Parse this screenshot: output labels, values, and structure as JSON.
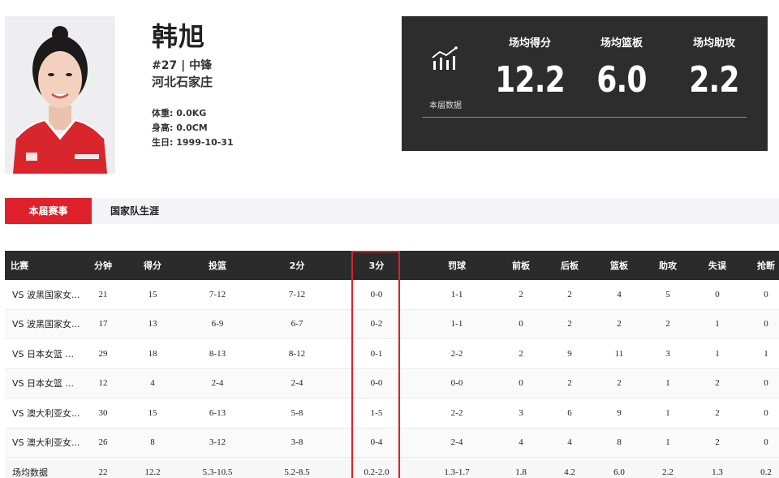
{
  "player": {
    "name": "韩旭",
    "number_position": "#27 | 中锋",
    "origin": "河北石家庄",
    "weight_label": "体重: ",
    "weight": "0.0KG",
    "height_label": "身高: ",
    "height": "0.0CM",
    "birth_label": "生日: ",
    "birth": "1999-10-31"
  },
  "season_stats": {
    "label": "本届数据",
    "icon": "chart-icon",
    "items": [
      {
        "label": "场均得分",
        "value": "12.2"
      },
      {
        "label": "场均篮板",
        "value": "6.0"
      },
      {
        "label": "场均助攻",
        "value": "2.2"
      }
    ]
  },
  "tabs": [
    {
      "label": "本届赛事",
      "active": true
    },
    {
      "label": "国家队生涯",
      "active": false
    }
  ],
  "table": {
    "headers": [
      "比赛",
      "分钟",
      "得分",
      "投篮",
      "2分",
      "3分",
      "罚球",
      "前板",
      "后板",
      "篮板",
      "助攻",
      "失误",
      "抢断"
    ],
    "rows": [
      [
        "VS 波黑国家女...",
        "21",
        "15",
        "7-12",
        "7-12",
        "0-0",
        "1-1",
        "2",
        "2",
        "4",
        "5",
        "0",
        "0"
      ],
      [
        "VS 波黑国家女...",
        "17",
        "13",
        "6-9",
        "6-7",
        "0-2",
        "1-1",
        "0",
        "2",
        "2",
        "2",
        "1",
        "0"
      ],
      [
        "VS 日本女篮 ...",
        "29",
        "18",
        "8-13",
        "8-12",
        "0-1",
        "2-2",
        "2",
        "9",
        "11",
        "3",
        "1",
        "1"
      ],
      [
        "VS 日本女篮 ...",
        "12",
        "4",
        "2-4",
        "2-4",
        "0-0",
        "0-0",
        "0",
        "2",
        "2",
        "1",
        "2",
        "0"
      ],
      [
        "VS 澳大利亚女...",
        "30",
        "15",
        "6-13",
        "5-8",
        "1-5",
        "2-2",
        "3",
        "6",
        "9",
        "1",
        "2",
        "0"
      ],
      [
        "VS 澳大利亚女...",
        "26",
        "8",
        "3-12",
        "3-8",
        "0-4",
        "2-4",
        "4",
        "4",
        "8",
        "1",
        "2",
        "0"
      ]
    ],
    "average": [
      "场均数据",
      "22",
      "12.2",
      "5.3-10.5",
      "5.2-8.5",
      "0.2-2.0",
      "1.3-1.7",
      "1.8",
      "4.2",
      "6.0",
      "2.2",
      "1.3",
      "0.2"
    ]
  },
  "colors": {
    "accent": "#e0202a",
    "dark": "#2d2d2d"
  }
}
